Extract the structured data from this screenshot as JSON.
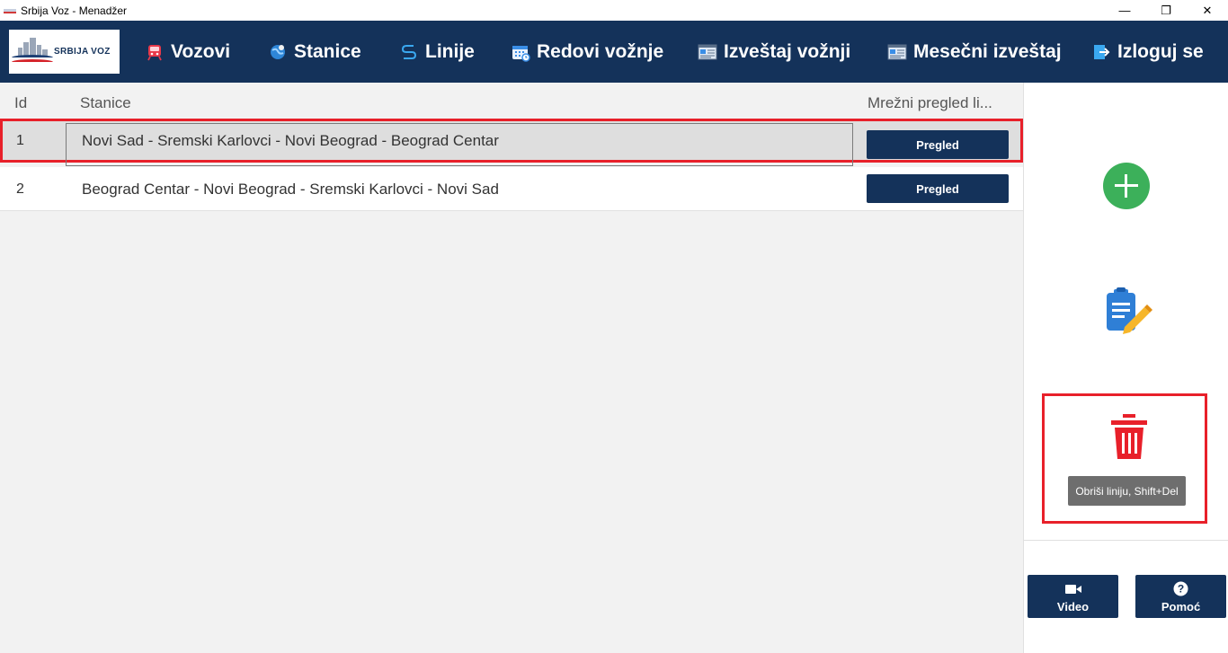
{
  "window": {
    "title": "Srbija Voz - Menadžer",
    "minimize_label": "—",
    "restore_label": "❐",
    "close_label": "✕"
  },
  "logo": {
    "text": "SRBIJA VOZ"
  },
  "nav": {
    "vozovi": "Vozovi",
    "stanice": "Stanice",
    "linije": "Linije",
    "redovi": "Redovi vožnje",
    "izvestaj": "Izveštaj vožnji",
    "mesecni": "Mesečni izveštaj",
    "izloguj": "Izloguj se"
  },
  "table": {
    "headers": {
      "id": "Id",
      "stanice": "Stanice",
      "pregled": "Mrežni pregled li..."
    },
    "rows": [
      {
        "id": "1",
        "stanice": "Novi Sad - Sremski Karlovci - Novi Beograd - Beograd Centar",
        "button": "Pregled"
      },
      {
        "id": "2",
        "stanice": "Beograd Centar - Novi Beograd - Sremski Karlovci - Novi Sad",
        "button": "Pregled"
      }
    ]
  },
  "side": {
    "delete_tooltip": "Obriši liniju, Shift+Del",
    "video_label": "Video",
    "help_label": "Pomoć"
  },
  "colors": {
    "navbar": "#14325a",
    "highlight": "#e8202a",
    "add": "#3cb05a",
    "delete": "#e8202a"
  }
}
